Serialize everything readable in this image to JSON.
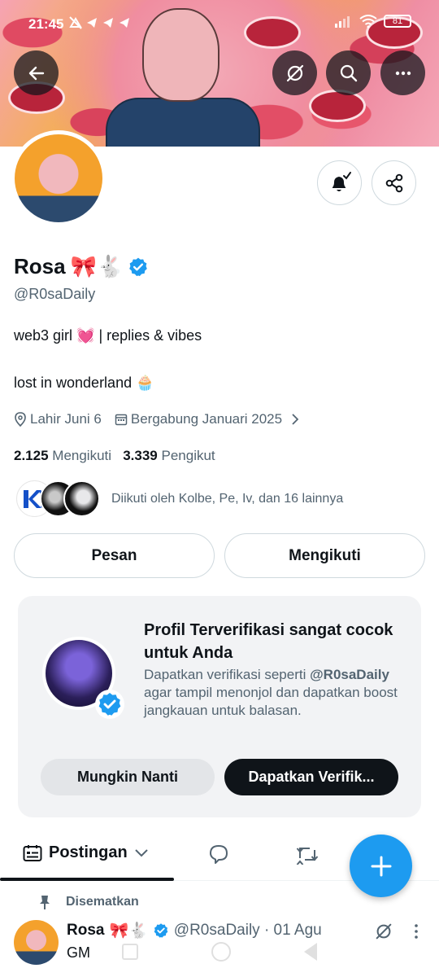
{
  "status_bar": {
    "time": "21:45",
    "notification_icons": [
      "bell-off-icon",
      "telegram-icon",
      "telegram-icon",
      "telegram-icon"
    ],
    "battery": "81"
  },
  "top_actions": [
    "back-arrow-icon",
    "grok-icon",
    "search-icon",
    "more-icon"
  ],
  "profile": {
    "name": "Rosa",
    "name_emojis": "🎀🐇",
    "handle": "@R0saDaily",
    "bio_line1": "web3 girl 💓 | replies & vibes",
    "bio_line2": "lost in wonderland 🧁",
    "birthday": "Lahir Juni 6",
    "joined": "Bergabung Januari 2025",
    "following_count": "2.125",
    "following_label": "Mengikuti",
    "followers_count": "3.339",
    "followers_label": "Pengikut",
    "followed_by": "Diikuti oleh Kolbe, Pe, Iv, dan 16 lainnya"
  },
  "buttons": {
    "message": "Pesan",
    "following": "Mengikuti"
  },
  "verify_card": {
    "title": "Profil Terverifikasi sangat cocok untuk Anda",
    "desc_prefix": "Dapatkan verifikasi seperti ",
    "desc_handle": "@R0saDaily",
    "desc_suffix": " agar tampil menonjol dan dapatkan boost jangkauan untuk balasan.",
    "later": "Mungkin Nanti",
    "verify": "Dapatkan Verifik..."
  },
  "tabs": {
    "posts": "Postingan"
  },
  "pinned": {
    "label": "Disematkan"
  },
  "post": {
    "name": "Rosa",
    "name_emojis": "🎀🐇",
    "handle_date": "@R0saDaily · 01 Agu",
    "text": "GM"
  },
  "colors": {
    "accent": "#1d9bf0",
    "text": "#0f1419",
    "muted": "#536471"
  }
}
